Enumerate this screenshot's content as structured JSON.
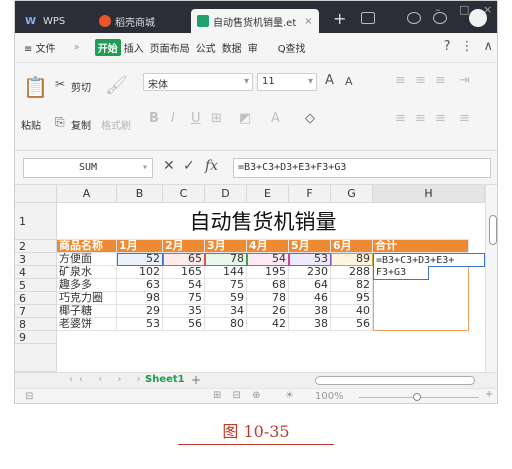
{
  "titlebar": {
    "tabs": [
      "WPS",
      "稻壳商城",
      "自动售货机销量.et"
    ],
    "window_controls": [
      "–",
      "□",
      "×"
    ]
  },
  "menu": {
    "items": [
      "≡ 文件",
      "»",
      "开始",
      "插入",
      "页面布局",
      "公式",
      "数据",
      "审",
      "Q查找"
    ],
    "right_icons": [
      "?",
      "⋮",
      "∧"
    ]
  },
  "ribbon": {
    "paste": "粘贴",
    "cut": "剪切",
    "copy": "复制",
    "format_painter": "格式刷",
    "font_name": "宋体",
    "font_size": "11"
  },
  "formula_bar": {
    "name_box": "SUM",
    "formula": "=B3+C3+D3+E3+F3+G3"
  },
  "grid": {
    "columns": [
      "A",
      "B",
      "C",
      "D",
      "E",
      "F",
      "G",
      "H"
    ],
    "row_numbers": [
      "1",
      "2",
      "3",
      "4",
      "5",
      "6",
      "7",
      "8",
      "9"
    ],
    "title": "自动售货机销量",
    "header": [
      "商品名称",
      "1月",
      "2月",
      "3月",
      "4月",
      "5月",
      "6月",
      "合计"
    ],
    "rows": [
      {
        "name": "方便面",
        "values": [
          "52",
          "65",
          "78",
          "54",
          "53",
          "89"
        ]
      },
      {
        "name": "矿泉水",
        "values": [
          "102",
          "165",
          "144",
          "195",
          "230",
          "288"
        ]
      },
      {
        "name": "趣多多",
        "values": [
          "63",
          "54",
          "75",
          "68",
          "64",
          "82"
        ]
      },
      {
        "name": "巧克力圈",
        "values": [
          "98",
          "75",
          "59",
          "78",
          "46",
          "95"
        ]
      },
      {
        "name": "椰子糖",
        "values": [
          "29",
          "35",
          "34",
          "26",
          "38",
          "40"
        ]
      },
      {
        "name": "老婆饼",
        "values": [
          "53",
          "56",
          "80",
          "42",
          "38",
          "56"
        ]
      }
    ],
    "edit_line1": "=B3+C3+D3+E3+",
    "edit_line2": "F3+G3"
  },
  "sheets": {
    "active": "Sheet1",
    "add": "+"
  },
  "status": {
    "zoom": "100%"
  },
  "caption": "图 10-35",
  "colors": {
    "header_fill": "#ee8a34",
    "active_tab_icon": "#22a06b",
    "selection": "#3a74d6"
  }
}
